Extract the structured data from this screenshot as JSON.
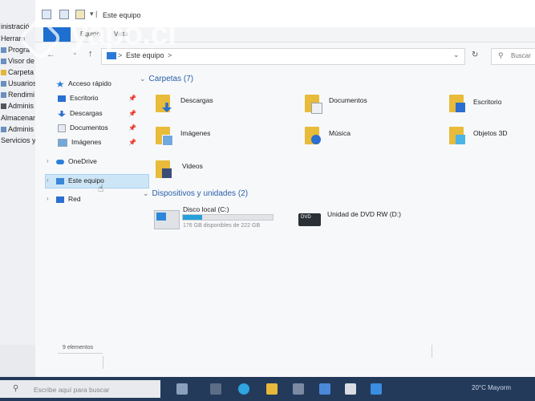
{
  "background_window": {
    "items": [
      "inistració",
      "Herram",
      "Progra",
      "Visor de",
      "Carpeta",
      "Usuarios",
      "Rendimi",
      "Adminis",
      "Almacenam",
      "Adminis",
      "Servicios y A"
    ]
  },
  "window": {
    "title": "Este equipo",
    "ribbon_tab": "Equipo",
    "ribbon_tab2": "Vista"
  },
  "address_bar": {
    "path": "Este equipo",
    "separator": ">",
    "search_placeholder": "Buscar"
  },
  "nav_pane": {
    "quick_access": "Acceso rápido",
    "quick_items": [
      "Escritorio",
      "Descargas",
      "Documentos",
      "Imágenes"
    ],
    "onedrive": "OneDrive",
    "este_equipo": "Este equipo",
    "red": "Red"
  },
  "content": {
    "folders_header": "Carpetas (7)",
    "folders": [
      "Descargas",
      "Documentos",
      "Escritorio",
      "Imágenes",
      "Música",
      "Objetos 3D",
      "Videos"
    ],
    "devices_header": "Dispositivos y unidades (2)",
    "drives": {
      "c_label": "Disco local (C:)",
      "c_free": "176 GB disponibles de 222 GB",
      "c_used_fraction": 0.21,
      "dvd_label": "Unidad de DVD RW (D:)",
      "dvd_badge": "DVD"
    }
  },
  "status_bar": {
    "count": "9 elementos"
  },
  "taskbar": {
    "search_placeholder": "Escribe aquí para buscar",
    "tray_text": "20°C  Mayorm"
  },
  "watermark": {
    "text": "yapo.cl"
  }
}
